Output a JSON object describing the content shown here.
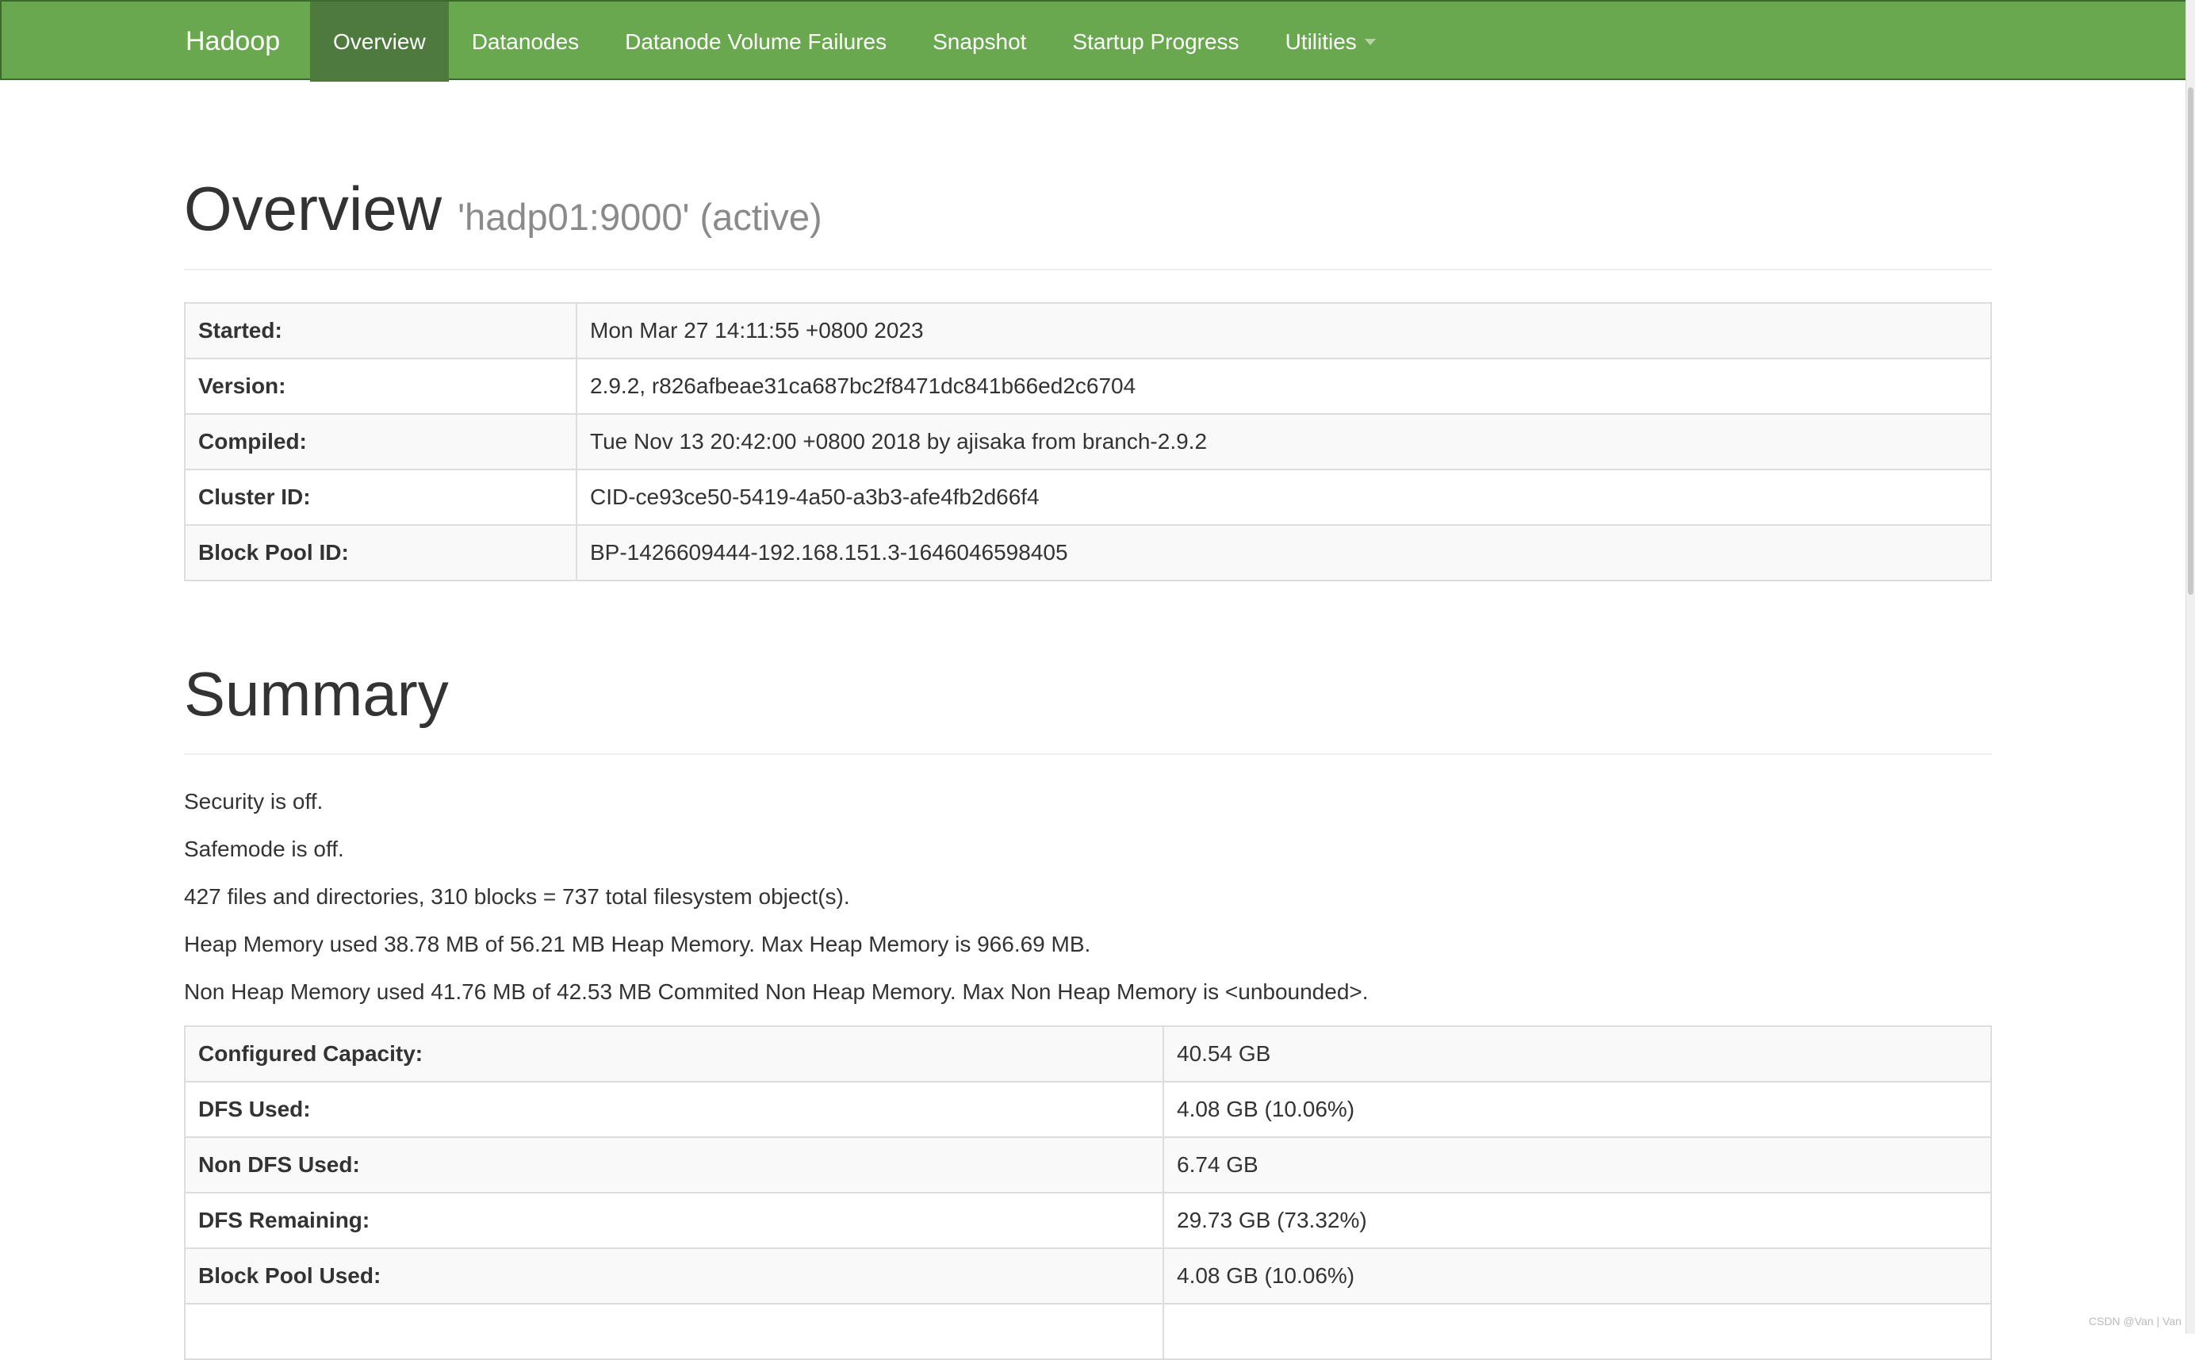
{
  "navbar": {
    "brand": "Hadoop",
    "items": [
      {
        "label": "Overview",
        "active": true
      },
      {
        "label": "Datanodes",
        "active": false
      },
      {
        "label": "Datanode Volume Failures",
        "active": false
      },
      {
        "label": "Snapshot",
        "active": false
      },
      {
        "label": "Startup Progress",
        "active": false
      },
      {
        "label": "Utilities",
        "active": false,
        "dropdown": true
      }
    ],
    "colors": {
      "background": "#6aa84f",
      "active": "#4e7a3d",
      "border": "#3b6a2c"
    }
  },
  "overview": {
    "title": "Overview",
    "subtitle": "'hadp01:9000' (active)",
    "rows": [
      {
        "key": "Started:",
        "value": "Mon Mar 27 14:11:55 +0800 2023"
      },
      {
        "key": "Version:",
        "value": "2.9.2, r826afbeae31ca687bc2f8471dc841b66ed2c6704"
      },
      {
        "key": "Compiled:",
        "value": "Tue Nov 13 20:42:00 +0800 2018 by ajisaka from branch-2.9.2"
      },
      {
        "key": "Cluster ID:",
        "value": "CID-ce93ce50-5419-4a50-a3b3-afe4fb2d66f4"
      },
      {
        "key": "Block Pool ID:",
        "value": "BP-1426609444-192.168.151.3-1646046598405"
      }
    ]
  },
  "summary": {
    "title": "Summary",
    "lines": [
      "Security is off.",
      "Safemode is off.",
      "427 files and directories, 310 blocks = 737 total filesystem object(s).",
      "Heap Memory used 38.78 MB of 56.21 MB Heap Memory. Max Heap Memory is 966.69 MB.",
      "Non Heap Memory used 41.76 MB of 42.53 MB Commited Non Heap Memory. Max Non Heap Memory is <unbounded>."
    ],
    "rows": [
      {
        "key": "Configured Capacity:",
        "value": "40.54 GB"
      },
      {
        "key": "DFS Used:",
        "value": "4.08 GB (10.06%)"
      },
      {
        "key": "Non DFS Used:",
        "value": "6.74 GB"
      },
      {
        "key": "DFS Remaining:",
        "value": "29.73 GB (73.32%)"
      },
      {
        "key": "Block Pool Used:",
        "value": "4.08 GB (10.06%)"
      },
      {
        "key": "",
        "value": ""
      }
    ]
  },
  "watermark": "CSDN @Van | Van"
}
